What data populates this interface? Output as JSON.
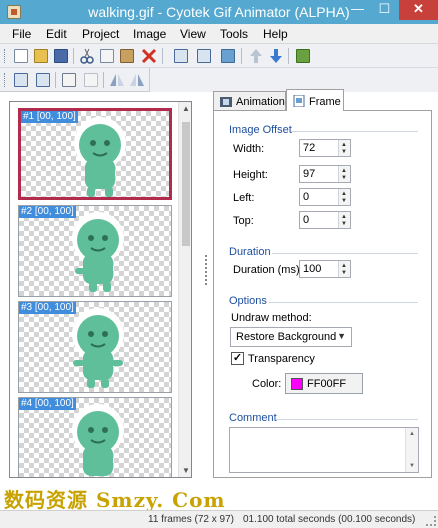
{
  "window": {
    "title": "walking.gif - Cyotek Gif Animator (ALPHA)",
    "minimize_glyph": "—",
    "maximize_glyph": "☐",
    "close_glyph": "✕"
  },
  "menu": [
    "File",
    "Edit",
    "Project",
    "Image",
    "View",
    "Tools",
    "Help"
  ],
  "toolbar": {
    "row1_icons": [
      "new-icon",
      "open-icon",
      "save-icon",
      "cut-icon",
      "copy-icon",
      "paste-icon",
      "delete-icon",
      "add-frame-icon",
      "insert-frame-icon",
      "image-icon",
      "move-up-icon",
      "move-down-icon",
      "export-icon"
    ],
    "row2_icons": [
      "import-icon",
      "export-frames-icon",
      "duplicate-icon",
      "duplicate-disabled-icon",
      "flip-icon",
      "mirror-icon"
    ]
  },
  "frames": [
    {
      "label": "#1 [00, 100]",
      "selected": true
    },
    {
      "label": "#2 [00, 100]",
      "selected": false
    },
    {
      "label": "#3 [00, 100]",
      "selected": false
    },
    {
      "label": "#4 [00, 100]",
      "selected": false
    }
  ],
  "tabs": {
    "animation": "Animation",
    "frame": "Frame",
    "active": "Frame"
  },
  "image_offset": {
    "title": "Image Offset",
    "width_label": "Width:",
    "width_value": "72",
    "height_label": "Height:",
    "height_value": "97",
    "left_label": "Left:",
    "left_value": "0",
    "top_label": "Top:",
    "top_value": "0"
  },
  "duration": {
    "title": "Duration",
    "label": "Duration (ms):",
    "value": "100"
  },
  "options": {
    "title": "Options",
    "undraw_label": "Undraw method:",
    "undraw_value": "Restore Background",
    "transparency_label": "Transparency",
    "transparency_checked": true,
    "check_glyph": "✓",
    "color_label": "Color:",
    "color_value": "FF00FF",
    "color_hex": "#ff00ff"
  },
  "comment": {
    "title": "Comment",
    "value": ""
  },
  "watermark": "数码资源 Smzy. Com",
  "status": {
    "frames_info": "11 frames (72 x 97)",
    "duration_info": "01.100 total seconds (00.100 seconds)"
  },
  "colors": {
    "titlebar": "#55a8cf",
    "selection_border": "#b32b4c",
    "frame_label_bg": "#3f8ddc",
    "alien_body": "#5fbf9a",
    "group_title": "#1f4fa0"
  }
}
